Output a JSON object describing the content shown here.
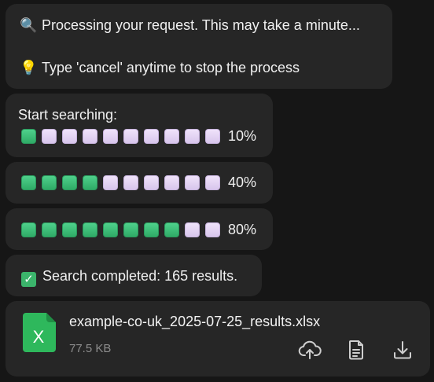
{
  "status_message": {
    "processing_icon": "magnifying-glass-icon",
    "processing_text": "Processing your request. This may take a minute...",
    "hint_icon": "lightbulb-icon",
    "hint_text": "Type 'cancel' anytime to stop the process"
  },
  "progress_updates": [
    {
      "heading": "Start searching:",
      "filled": 1,
      "total": 10,
      "percent_label": "10%"
    },
    {
      "filled": 4,
      "total": 10,
      "percent_label": "40%"
    },
    {
      "filled": 8,
      "total": 10,
      "percent_label": "80%"
    }
  ],
  "completion": {
    "icon": "check-box-icon",
    "text": "Search completed: 165 results."
  },
  "file": {
    "icon": "excel-file-icon",
    "icon_letter": "X",
    "name": "example-co-uk_2025-07-25_results.xlsx",
    "size": "77.5 KB",
    "actions": [
      "upload-cloud-icon",
      "document-icon",
      "download-icon"
    ]
  },
  "colors": {
    "background": "#161616",
    "bubble": "#262626",
    "progress_filled": "#3bbd74",
    "progress_empty": "#e4d4f4",
    "excel_green": "#2eb85c",
    "muted_text": "#8c8c8c"
  }
}
